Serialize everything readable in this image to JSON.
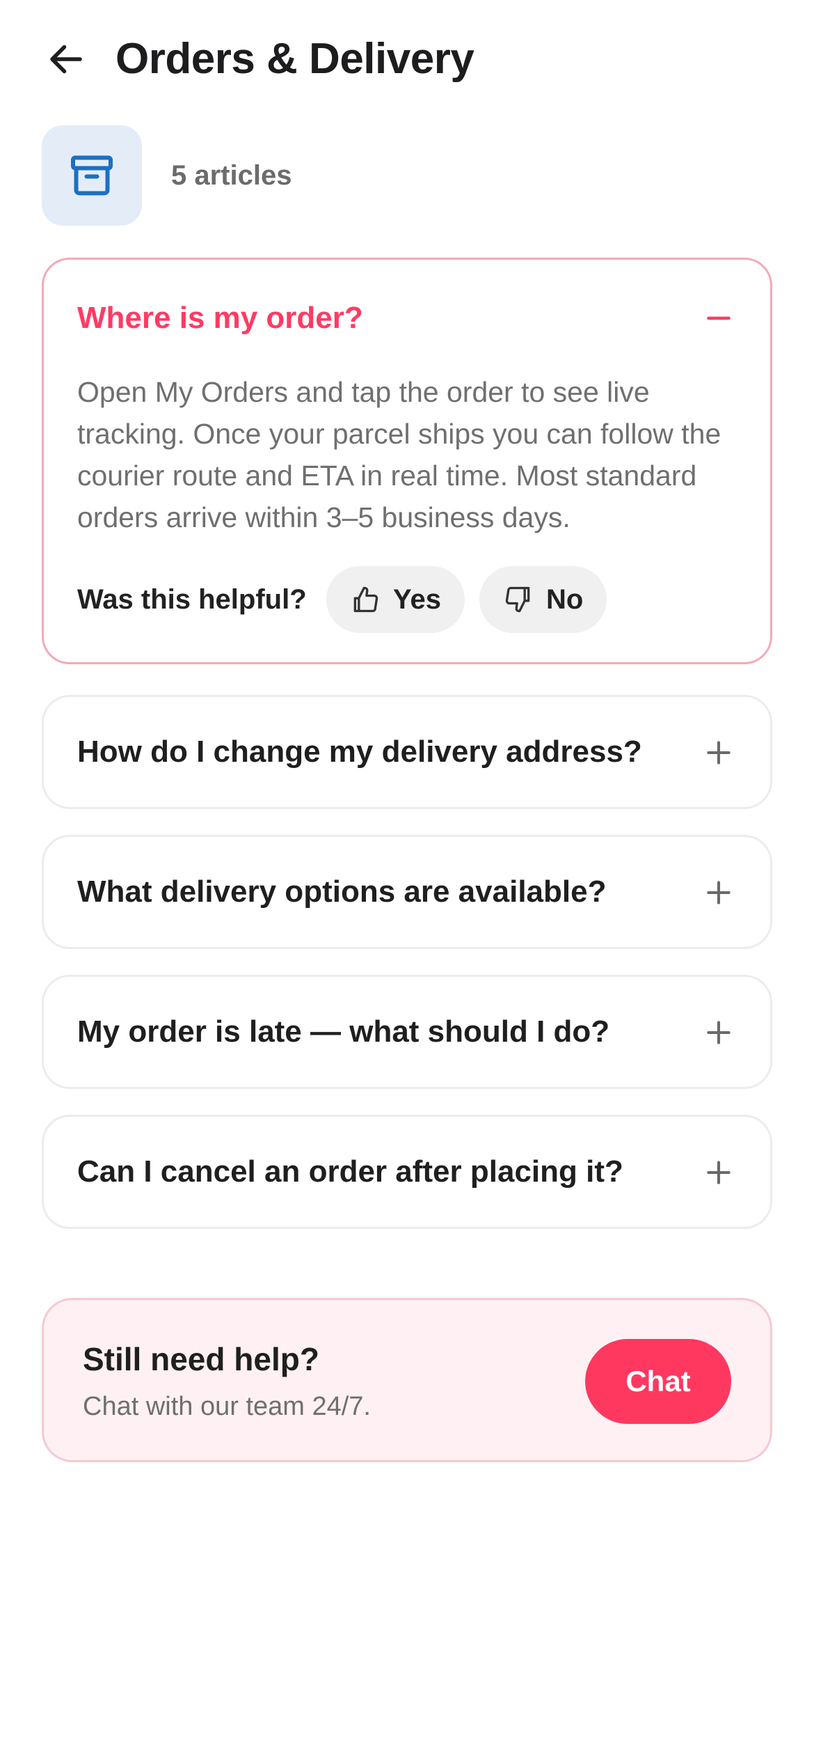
{
  "header": {
    "title": "Orders & Delivery",
    "back_icon": "arrow-left-icon"
  },
  "category": {
    "icon": "archive-box-icon",
    "icon_color": "#1e6fc0",
    "icon_bg": "#e4edf7",
    "article_count": "5 articles"
  },
  "faqs": [
    {
      "question": "Where is my order?",
      "expanded": true,
      "answer": "Open My Orders and tap the order to see live tracking. Once your parcel ships you can follow the courier route and ETA in real time. Most standard orders arrive within 3–5 business days.",
      "helpful_prompt": "Was this helpful?",
      "yes_label": "Yes",
      "no_label": "No"
    },
    {
      "question": "How do I change my delivery address?",
      "expanded": false
    },
    {
      "question": "What delivery options are available?",
      "expanded": false
    },
    {
      "question": "My order is late — what should I do?",
      "expanded": false
    },
    {
      "question": "Can I cancel an order after placing it?",
      "expanded": false
    }
  ],
  "help": {
    "title": "Still need help?",
    "subtitle": "Chat with our team 24/7.",
    "chat_label": "Chat"
  },
  "colors": {
    "accent": "#ff3860",
    "open_border": "#f5a8b8",
    "help_bg": "#fff1f3"
  }
}
